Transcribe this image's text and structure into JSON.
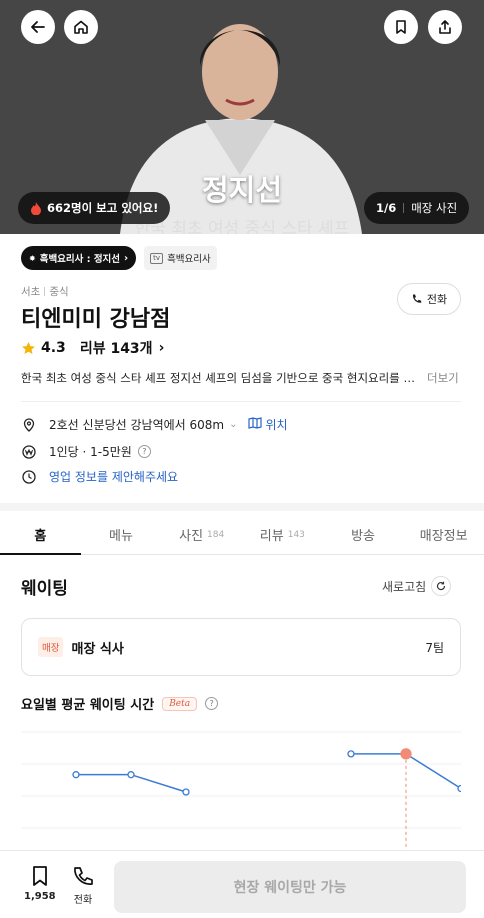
{
  "hero": {
    "caption_name": "정지선",
    "caption_sub": "한국 최초 여성 중식 스타 셰프",
    "viewers": "662명이 보고 있어요!",
    "photo_counter": "1/6",
    "photo_label": "매장 사진"
  },
  "tags": {
    "show_tag": "흑백요리사 : 정지선",
    "tv_box": "tv",
    "tv_tag": "흑백요리사"
  },
  "store": {
    "category_region": "서초",
    "category_type": "중식",
    "name": "티엔미미 강남점",
    "call_label": "전화",
    "rating": "4.3",
    "reviews": "리뷰 143개",
    "description": "한국 최초 여성 중식 스타 셰프 정지선 셰프의 딤섬을 기반으로 중국 현지요리를 선보이는 곳",
    "more": "더보기"
  },
  "info": {
    "location": "2호선 신분당선 강남역에서 608m",
    "location_link": "위치",
    "price": "1인당 · 1-5만원",
    "hours_link": "영업 정보를 제안해주세요"
  },
  "tabs": [
    {
      "label": "홈",
      "count": ""
    },
    {
      "label": "메뉴",
      "count": ""
    },
    {
      "label": "사진",
      "count": "184"
    },
    {
      "label": "리뷰",
      "count": "143"
    },
    {
      "label": "방송",
      "count": ""
    },
    {
      "label": "매장정보",
      "count": ""
    }
  ],
  "waiting": {
    "title": "웨이팅",
    "refresh": "새로고침",
    "badge": "매장",
    "card_label": "매장 식사",
    "card_value": "7팀",
    "avg_title": "요일별 평균 웨이팅 시간",
    "beta": "Beta",
    "help": "?"
  },
  "chart_data": {
    "type": "line",
    "series": [
      {
        "values": [
          null,
          2,
          2,
          1.5,
          null,
          null,
          2.6,
          2.6,
          1.6
        ]
      }
    ],
    "highlight_index": 7
  },
  "bottom": {
    "bookmark_count": "1,958",
    "call_label": "전화",
    "cta": "현장 웨이팅만 가능"
  },
  "colors": {
    "accent": "#e0583a",
    "link": "#2764c5",
    "chart_line": "#3a7bd5",
    "highlight": "#f28b74"
  }
}
